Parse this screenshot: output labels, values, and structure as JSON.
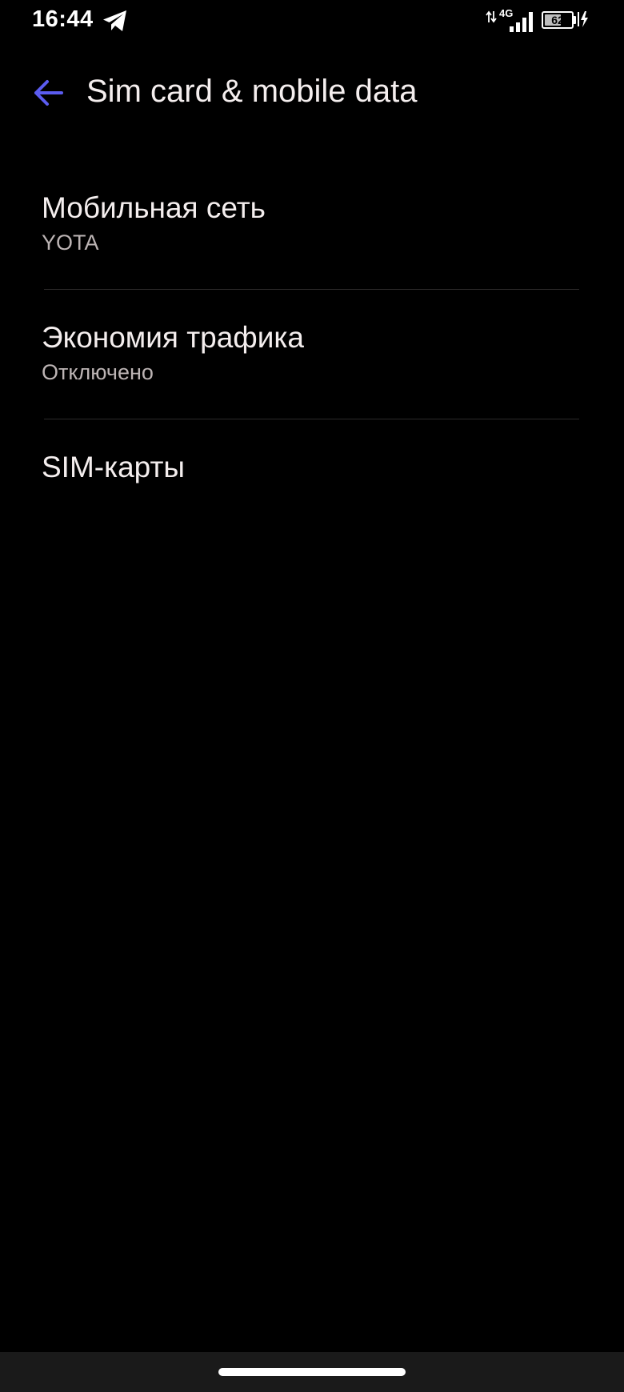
{
  "status_bar": {
    "time": "16:44",
    "network_type": "4G",
    "battery_level": "62",
    "battery_fraction": 0.62,
    "icons": [
      "telegram-icon",
      "data-arrows-icon",
      "signal-icon",
      "battery-icon",
      "charging-icon"
    ]
  },
  "toolbar": {
    "title": "Sim card & mobile data",
    "back_icon": "arrow-left-icon"
  },
  "settings": {
    "items": [
      {
        "title": "Мобильная сеть",
        "summary": "YOTA"
      },
      {
        "title": "Экономия трафика",
        "summary": "Отключено"
      },
      {
        "title": "SIM-карты"
      }
    ]
  },
  "colors": {
    "background": "#000000",
    "accent": "#5b5cf0",
    "text_primary": "#f4eeee",
    "text_secondary": "#bcb4b4"
  }
}
